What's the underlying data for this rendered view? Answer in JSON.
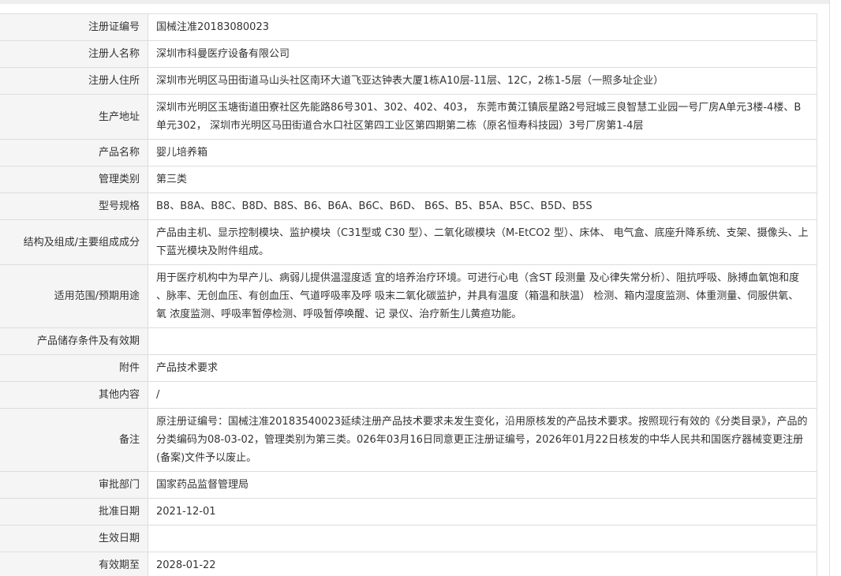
{
  "rows": [
    {
      "label": "注册证编号",
      "value": "国械注准20183080023"
    },
    {
      "label": "注册人名称",
      "value": "深圳市科曼医疗设备有限公司"
    },
    {
      "label": "注册人住所",
      "value": "深圳市光明区马田街道马山头社区南环大道飞亚达钟表大厦1栋A10层-11层、12C，2栋1-5层（一照多址企业）"
    },
    {
      "label": "生产地址",
      "value": "深圳市光明区玉塘街道田寮社区先能路86号301、302、402、403， 东莞市黄江镇辰星路2号冠城三良智慧工业园一号厂房A单元3楼-4楼、B单元302， 深圳市光明区马田街道合水口社区第四工业区第四期第二栋（原名恒寿科技园）3号厂房第1-4层"
    },
    {
      "label": "产品名称",
      "value": "婴儿培养箱"
    },
    {
      "label": "管理类别",
      "value": "第三类"
    },
    {
      "label": "型号规格",
      "value": "B8、B8A、B8C、B8D、B8S、B6、B6A、B6C、B6D、 B6S、B5、B5A、B5C、B5D、B5S"
    },
    {
      "label": "结构及组成/主要组成成分",
      "value": "产品由主机、显示控制模块、监护模块（C31型或 C30 型）、二氧化碳模块（M-EtCO2 型）、床体、 电气盒、底座升降系统、支架、摄像头、上下蓝光模块及附件组成。"
    },
    {
      "label": "适用范围/预期用途",
      "value": "用于医疗机构中为早产儿、病弱儿提供温湿度适 宜的培养治疗环境。可进行心电（含ST 段测量 及心律失常分析）、阻抗呼吸、脉搏血氧饱和度 、脉率、无创血压、有创血压、气道呼吸率及呼 吸末二氧化碳监护，并具有温度（箱温和肤温） 检测、箱内湿度监测、体重测量、伺服供氧、氧 浓度监测、呼吸率暂停检测、呼吸暂停唤醒、记 录仪、治疗新生儿黄疸功能。"
    },
    {
      "label": "产品储存条件及有效期",
      "value": ""
    },
    {
      "label": "附件",
      "value": "产品技术要求"
    },
    {
      "label": "其他内容",
      "value": "/"
    },
    {
      "label": "备注",
      "value": "原注册证编号：国械注准20183540023延续注册产品技术要求未发生变化，沿用原核发的产品技术要求。按照现行有效的《分类目录》，产品的分类编码为08-03-02，管理类别为第三类。026年03月16日同意更正注册证编号，2026年01月22日核发的中华人民共和国医疗器械变更注册(备案)文件予以废止。"
    },
    {
      "label": "审批部门",
      "value": "国家药品监督管理局"
    },
    {
      "label": "批准日期",
      "value": "2021-12-01"
    },
    {
      "label": "生效日期",
      "value": ""
    },
    {
      "label": "有效期至",
      "value": "2028-01-22"
    }
  ]
}
